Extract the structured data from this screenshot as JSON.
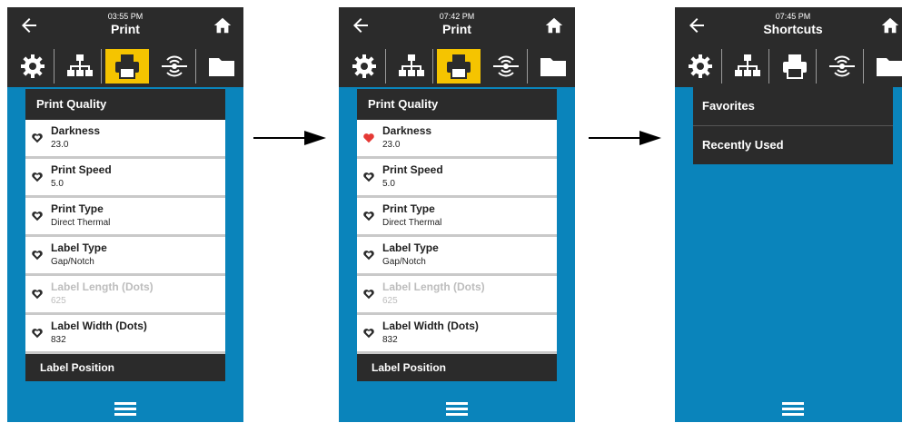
{
  "panels": [
    {
      "time": "03:55 PM",
      "title": "Print",
      "header": "Print Quality",
      "items": [
        {
          "label": "Darkness",
          "value": "23.0"
        },
        {
          "label": "Print Speed",
          "value": "5.0"
        },
        {
          "label": "Print Type",
          "value": "Direct Thermal"
        },
        {
          "label": "Label Type",
          "value": "Gap/Notch"
        },
        {
          "label": "Label Length (Dots)",
          "value": "625"
        },
        {
          "label": "Label Width (Dots)",
          "value": "832"
        }
      ],
      "footer": "Label Position"
    },
    {
      "time": "07:42 PM",
      "title": "Print",
      "header": "Print Quality",
      "items": [
        {
          "label": "Darkness",
          "value": "23.0"
        },
        {
          "label": "Print Speed",
          "value": "5.0"
        },
        {
          "label": "Print Type",
          "value": "Direct Thermal"
        },
        {
          "label": "Label Type",
          "value": "Gap/Notch"
        },
        {
          "label": "Label Length (Dots)",
          "value": "625"
        },
        {
          "label": "Label Width (Dots)",
          "value": "832"
        }
      ],
      "footer": "Label Position"
    },
    {
      "time": "07:45 PM",
      "title": "Shortcuts",
      "menu": [
        "Favorites",
        "Recently Used"
      ]
    }
  ],
  "colors": {
    "accent": "#f5c400",
    "background": "#0a84bb",
    "bar": "#2b2b2b",
    "favorite": "#e53935"
  }
}
